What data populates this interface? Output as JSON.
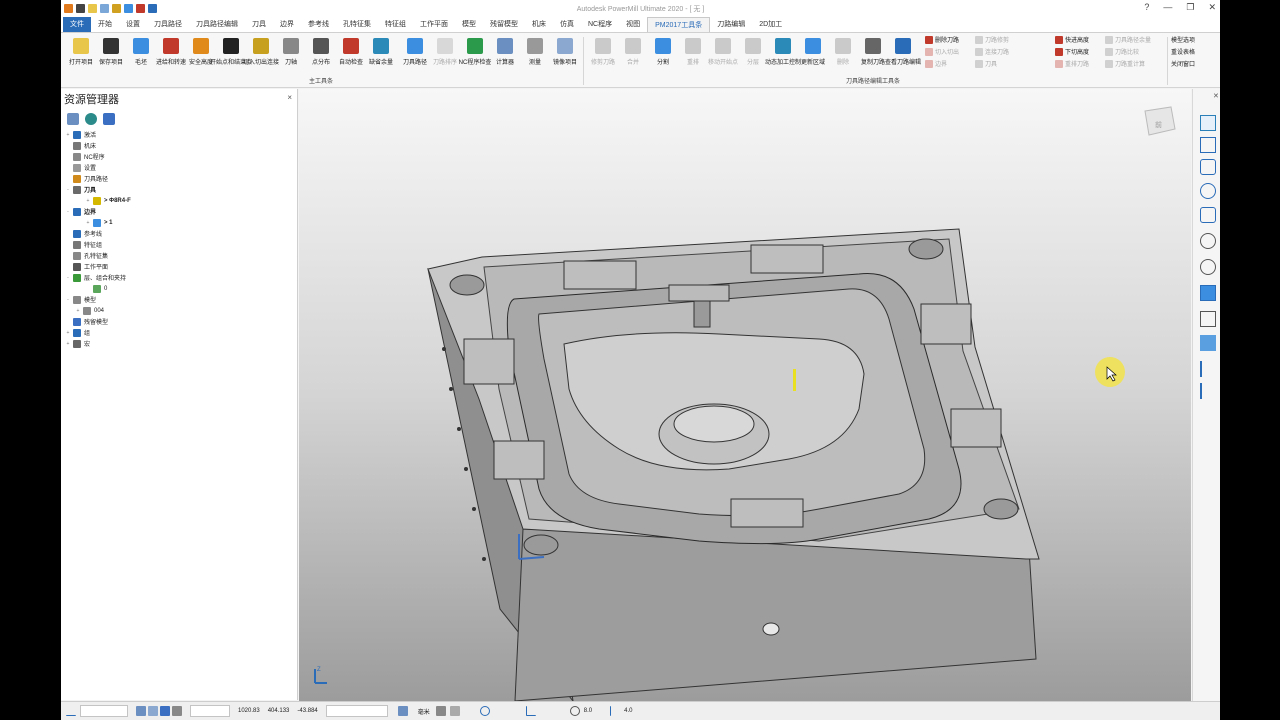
{
  "window": {
    "title": "Autodesk PowerMill Ultimate 2020 - [ 无 ]",
    "help_glyph": "?",
    "minimize_glyph": "—",
    "restore_glyph": "❐",
    "close_glyph": "✕"
  },
  "menu": {
    "tabs": [
      "文件",
      "开始",
      "设置",
      "刀具路径",
      "刀具路径编辑",
      "刀具",
      "边界",
      "参考线",
      "孔特征集",
      "特征组",
      "工作平面",
      "模型",
      "残留模型",
      "机床",
      "仿真",
      "NC程序",
      "视图",
      "PM2017工具条",
      "刀路编辑",
      "2D加工"
    ],
    "active_tab": "PM2017工具条"
  },
  "ribbon": {
    "main_group_label": "主工具条",
    "edit_group_label": "刀具路径编辑工具条",
    "main_buttons": [
      "打开项目",
      "保存项目",
      "毛坯",
      "进给和转速",
      "安全高度",
      "开始点和结束点",
      "切入切出连接",
      "刀轴",
      "点分布",
      "自动检查",
      "缺省余量",
      "刀具路径",
      "刀路排序",
      "NC程序检查",
      "计算器",
      "测量",
      "镜像项目"
    ],
    "edit_buttons": [
      "修剪刀路",
      "合并",
      "分割",
      "重排",
      "移动开始点",
      "分层",
      "动态加工控制",
      "更新区域",
      "删除",
      "复制刀路",
      "查看刀路编辑"
    ],
    "edit_small_col1": [
      "删除刀路",
      "切入切出",
      "边界"
    ],
    "edit_small_col2": [
      "刀路修剪",
      "连接刀路",
      "刀具"
    ],
    "edit_small_col3": [
      "快进高度",
      "下切高度",
      "重排刀路"
    ],
    "edit_small_col4": [
      "刀具路径余量",
      "刀路比较",
      "刀路重计算"
    ],
    "right_items": [
      "模型选项",
      "重设表格",
      "关闭窗口"
    ]
  },
  "explorer": {
    "title": "资源管理器",
    "close_glyph": "×",
    "tree": [
      {
        "label": "激活",
        "level": 0,
        "expand": "+",
        "icon_color": "#2b6cb8"
      },
      {
        "label": "机床",
        "level": 0,
        "expand": "",
        "icon_color": "#777"
      },
      {
        "label": "NC程序",
        "level": 0,
        "expand": "",
        "icon_color": "#888"
      },
      {
        "label": "设置",
        "level": 0,
        "expand": "",
        "icon_color": "#999"
      },
      {
        "label": "刀具路径",
        "level": 0,
        "expand": "",
        "icon_color": "#d08a1c"
      },
      {
        "label": "刀具",
        "level": 0,
        "expand": "-",
        "icon_color": "#6a6a6a",
        "bold": true
      },
      {
        "label": "> Φ8R4-F",
        "level": 2,
        "expand": "+",
        "icon_color": "#d4b800",
        "bold": true
      },
      {
        "label": "边界",
        "level": 0,
        "expand": "-",
        "icon_color": "#2b6cb8",
        "bold": true
      },
      {
        "label": "> 1",
        "level": 2,
        "expand": "+",
        "icon_color": "#3b8ee0",
        "bold": true
      },
      {
        "label": "参考线",
        "level": 0,
        "expand": "",
        "icon_color": "#2b6cb8"
      },
      {
        "label": "特征组",
        "level": 0,
        "expand": "",
        "icon_color": "#777"
      },
      {
        "label": "孔特征集",
        "level": 0,
        "expand": "",
        "icon_color": "#888"
      },
      {
        "label": "工作平面",
        "level": 0,
        "expand": "",
        "icon_color": "#555"
      },
      {
        "label": "层、组合和夹持",
        "level": 0,
        "expand": "-",
        "icon_color": "#3a9a3a"
      },
      {
        "label": "0",
        "level": 2,
        "expand": "",
        "icon_color": "#5aa65a"
      },
      {
        "label": "模型",
        "level": 0,
        "expand": "-",
        "icon_color": "#888"
      },
      {
        "label": "004",
        "level": 1,
        "expand": "+",
        "icon_color": "#888"
      },
      {
        "label": "残留模型",
        "level": 0,
        "expand": "",
        "icon_color": "#3b6fc2"
      },
      {
        "label": "组",
        "level": 0,
        "expand": "+",
        "icon_color": "#2b6cb8"
      },
      {
        "label": "宏",
        "level": 0,
        "expand": "+",
        "icon_color": "#666"
      }
    ]
  },
  "viewport": {
    "viewcube_label": "前",
    "axis_label": "Z"
  },
  "status": {
    "x": "1020.83",
    "y": "404.133",
    "z": "-43.884",
    "units": "毫米",
    "tolerance": "8.0",
    "step": "4.0"
  },
  "colors": {
    "accent": "#2b6cb8",
    "tool_yellow": "#e8e020",
    "cursor_highlight": "#f2e34a"
  }
}
